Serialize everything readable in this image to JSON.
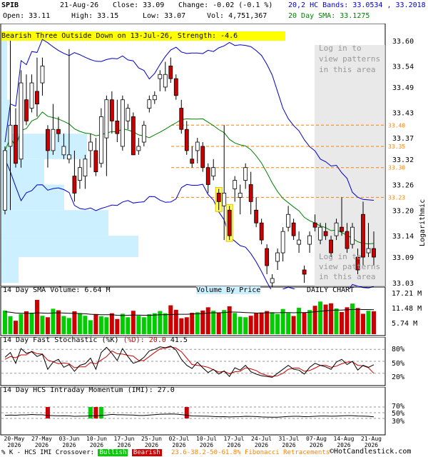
{
  "header": {
    "symbol": "SPIB",
    "date": "21-Aug-26",
    "close": "Close: 33.09",
    "change": "Change: -0.02 (-0.1 %)",
    "open": "Open: 33.11",
    "high": "High: 33.15",
    "low": "Low: 33.07",
    "vol": "Vol: 4,751,367",
    "bands": "20,2 HC Bands: 33.0534 , 33.2018",
    "sma": "20 Day SMA: 33.1275",
    "pattern": "Bearish Three Outside Down on 13-Jul-26, Strength: -4.6"
  },
  "overlay": {
    "login_top": [
      "Log in to",
      "view patterns",
      "in this area"
    ],
    "login_bottom": [
      "Log in to",
      "view patterns",
      "in this area"
    ],
    "logarithmic": "Logarithmic",
    "vbp": "Volume By Price",
    "daily": "DAILY CHART"
  },
  "price_axis": [
    "33.60",
    "33.54",
    "33.49",
    "33.43",
    "33.37",
    "33.32",
    "33.26",
    "33.20",
    "33.14",
    "33.09",
    "33.03"
  ],
  "fib_labels": [
    "33.40",
    "33.35",
    "33.30",
    "33.23"
  ],
  "volume_panel": {
    "title": "14 Day SMA Volume: 6.64 M",
    "axis": [
      "17.21 M",
      "11.48 M",
      "5.74 M"
    ]
  },
  "stoch_panel": {
    "title_k": "14 Day Fast Stochastic (%K)",
    "title_d": "(%D):",
    "d_val": "20.0",
    "k_val": "41.5",
    "axis": [
      "80%",
      "50%",
      "20%"
    ]
  },
  "hcs_panel": {
    "title": "14 Day HCS Intraday Momentum (IMI): 27.0",
    "axis": [
      "70%",
      "50%",
      "30%"
    ]
  },
  "x_axis": [
    "20-May",
    "27-May",
    "03-Jun",
    "10-Jun",
    "17-Jun",
    "25-Jun",
    "02-Jul",
    "10-Jul",
    "17-Jul",
    "24-Jul",
    "31-Jul",
    "07-Aug",
    "14-Aug",
    "21-Aug"
  ],
  "x_year": "2026",
  "footer": {
    "left": "% K - HCS IMI Crossover:",
    "bull": "Bullish",
    "bear": "Bearish",
    "fib": "23.6-38.2-50-61.8% Fibonacci Retracements",
    "brand": "©HotCandlestick.com"
  },
  "colors": {
    "up": "#00cc00",
    "down": "#cc0000",
    "band": "#0000cc",
    "sma": "#008000",
    "vbp": "#ccf0ff",
    "fib": "#ff8000"
  },
  "chart_data": {
    "type": "candlestick",
    "ylim": [
      33.03,
      33.6
    ],
    "log_scale": true,
    "candles": [
      [
        33.2,
        33.35,
        33.19,
        33.34
      ],
      [
        33.35,
        33.6,
        33.2,
        33.4
      ],
      [
        33.4,
        33.44,
        33.3,
        33.31
      ],
      [
        33.32,
        33.53,
        33.3,
        33.5
      ],
      [
        33.46,
        33.52,
        33.4,
        33.41
      ],
      [
        33.44,
        33.52,
        33.43,
        33.5
      ],
      [
        33.48,
        33.56,
        33.42,
        33.45
      ],
      [
        33.5,
        33.56,
        33.47,
        33.54
      ],
      [
        33.39,
        33.4,
        33.3,
        33.34
      ],
      [
        33.34,
        33.45,
        33.33,
        33.39
      ],
      [
        33.39,
        33.42,
        33.36,
        33.38
      ],
      [
        33.33,
        33.38,
        33.32,
        33.35
      ],
      [
        33.32,
        33.58,
        33.31,
        33.33
      ],
      [
        33.28,
        33.34,
        33.22,
        33.24
      ],
      [
        33.27,
        33.32,
        33.25,
        33.3
      ],
      [
        33.28,
        33.33,
        33.25,
        33.32
      ],
      [
        33.34,
        33.38,
        33.3,
        33.36
      ],
      [
        33.34,
        33.37,
        33.28,
        33.29
      ],
      [
        33.31,
        33.44,
        33.3,
        33.42
      ],
      [
        33.37,
        33.47,
        33.28,
        33.46
      ],
      [
        33.46,
        33.48,
        33.38,
        33.41
      ],
      [
        33.41,
        33.46,
        33.36,
        33.38
      ],
      [
        33.35,
        33.47,
        33.34,
        33.46
      ],
      [
        33.41,
        33.45,
        33.39,
        33.44
      ],
      [
        33.42,
        33.43,
        33.37,
        33.33
      ],
      [
        33.34,
        33.37,
        33.33,
        33.35
      ],
      [
        33.36,
        33.41,
        33.35,
        33.4
      ],
      [
        33.44,
        33.47,
        33.43,
        33.46
      ],
      [
        33.46,
        33.48,
        33.45,
        33.47
      ],
      [
        33.51,
        33.53,
        33.48,
        33.52
      ],
      [
        33.49,
        33.55,
        33.48,
        33.52
      ],
      [
        33.54,
        33.56,
        33.5,
        33.51
      ],
      [
        33.51,
        33.52,
        33.46,
        33.47
      ],
      [
        33.44,
        33.46,
        33.38,
        33.39
      ],
      [
        33.39,
        33.41,
        33.33,
        33.34
      ],
      [
        33.32,
        33.35,
        33.3,
        33.31
      ],
      [
        33.34,
        33.37,
        33.31,
        33.36
      ],
      [
        33.35,
        33.36,
        33.29,
        33.3
      ],
      [
        33.3,
        33.31,
        33.24,
        33.26
      ],
      [
        33.28,
        33.32,
        33.27,
        33.3
      ],
      [
        33.24,
        33.25,
        33.2,
        33.22
      ],
      [
        33.21,
        33.4,
        33.13,
        33.24
      ],
      [
        33.2,
        33.21,
        33.13,
        33.14
      ],
      [
        33.25,
        33.28,
        33.22,
        33.27
      ],
      [
        33.23,
        33.26,
        33.19,
        33.24
      ],
      [
        33.27,
        33.31,
        33.25,
        33.3
      ],
      [
        33.26,
        33.29,
        33.19,
        33.22
      ],
      [
        33.2,
        33.23,
        33.16,
        33.17
      ],
      [
        33.17,
        33.18,
        33.12,
        33.13
      ],
      [
        33.11,
        33.12,
        33.05,
        33.07
      ],
      [
        33.03,
        33.05,
        33.02,
        33.04
      ],
      [
        33.08,
        33.11,
        33.06,
        33.1
      ],
      [
        33.1,
        33.16,
        33.08,
        33.15
      ],
      [
        33.16,
        33.21,
        33.15,
        33.19
      ],
      [
        33.17,
        33.18,
        33.13,
        33.14
      ],
      [
        33.12,
        33.15,
        33.1,
        33.13
      ],
      [
        33.06,
        33.07,
        33.03,
        33.05
      ],
      [
        33.12,
        33.15,
        33.1,
        33.14
      ],
      [
        33.17,
        33.19,
        33.15,
        33.16
      ],
      [
        33.13,
        33.17,
        33.12,
        33.16
      ],
      [
        33.15,
        33.17,
        33.13,
        33.14
      ],
      [
        33.13,
        33.14,
        33.09,
        33.1
      ],
      [
        33.14,
        33.18,
        33.13,
        33.17
      ],
      [
        33.16,
        33.23,
        33.14,
        33.15
      ],
      [
        33.15,
        33.17,
        33.1,
        33.11
      ],
      [
        33.12,
        33.17,
        33.11,
        33.16
      ],
      [
        33.09,
        33.11,
        33.05,
        33.06
      ],
      [
        33.19,
        33.22,
        33.07,
        33.09
      ],
      [
        33.1,
        33.17,
        33.09,
        33.11
      ],
      [
        33.11,
        33.15,
        33.07,
        33.09
      ]
    ],
    "pattern_highlights": [
      40,
      42
    ],
    "volume": [
      9.5,
      7.2,
      5.4,
      8.1,
      9.2,
      8.6,
      13.8,
      7.4,
      6.8,
      10.2,
      9.6,
      7.3,
      6.5,
      9.2,
      8.4,
      7.4,
      5.6,
      8.1,
      7.2,
      6.8,
      8.4,
      6.1,
      8.2,
      6.8,
      9.4,
      7.4,
      6.8,
      8.0,
      8.4,
      9.3,
      8.4,
      11.6,
      9.8,
      6.4,
      6.8,
      8.6,
      8.8,
      9.5,
      10.8,
      9.4,
      8.5,
      9.7,
      11.2,
      8.5,
      7.0,
      6.8,
      7.4,
      8.4,
      8.7,
      9.3,
      8.8,
      8.1,
      10.1,
      8.5,
      7.3,
      10.6,
      8.6,
      9.7,
      11.4,
      13.1,
      11.9,
      12.4,
      10.3,
      8.9,
      10.8,
      12.3,
      10.5,
      8.2,
      9.4,
      9.2
    ],
    "vol_sma": [
      9.0,
      8.8,
      8.5,
      8.4,
      8.4,
      8.4,
      8.6,
      8.5,
      8.4,
      8.5,
      8.6,
      8.5,
      8.4,
      8.4,
      8.3,
      8.2,
      8.0,
      7.9,
      7.8,
      7.8,
      7.8,
      7.6,
      7.5,
      7.6,
      7.7,
      7.7,
      7.6,
      7.6,
      7.7,
      7.8,
      7.8,
      7.9,
      8.0,
      8.0,
      8.0,
      8.1,
      8.2,
      8.3,
      8.5,
      8.6,
      8.6,
      8.7,
      8.9,
      8.9,
      8.8,
      8.7,
      8.6,
      8.5,
      8.5,
      8.6,
      8.6,
      8.6,
      8.7,
      8.7,
      8.6,
      8.7,
      8.7,
      8.8,
      9.0,
      9.2,
      9.4,
      9.6,
      9.7,
      9.7,
      9.8,
      9.9,
      10.0,
      9.9,
      9.9,
      9.8
    ],
    "stoch_k": [
      60,
      72,
      45,
      82,
      70,
      74,
      62,
      68,
      30,
      48,
      55,
      35,
      42,
      25,
      40,
      44,
      58,
      30,
      72,
      85,
      70,
      52,
      82,
      62,
      45,
      50,
      60,
      76,
      80,
      86,
      84,
      88,
      78,
      55,
      40,
      32,
      48,
      34,
      22,
      30,
      18,
      26,
      12,
      34,
      28,
      40,
      24,
      18,
      14,
      12,
      10,
      20,
      30,
      40,
      30,
      28,
      18,
      35,
      45,
      40,
      36,
      30,
      48,
      55,
      42,
      50,
      28,
      40,
      35,
      41.5
    ],
    "stoch_d": [
      55,
      62,
      59,
      66,
      66,
      75,
      69,
      68,
      53,
      49,
      44,
      46,
      44,
      34,
      36,
      36,
      47,
      44,
      53,
      62,
      76,
      69,
      68,
      65,
      63,
      52,
      52,
      62,
      72,
      81,
      83,
      86,
      83,
      74,
      58,
      42,
      40,
      38,
      35,
      29,
      23,
      25,
      19,
      24,
      25,
      34,
      31,
      27,
      19,
      15,
      12,
      14,
      20,
      30,
      33,
      33,
      25,
      27,
      33,
      40,
      40,
      35,
      38,
      44,
      48,
      49,
      40,
      39,
      34,
      20
    ]
  }
}
